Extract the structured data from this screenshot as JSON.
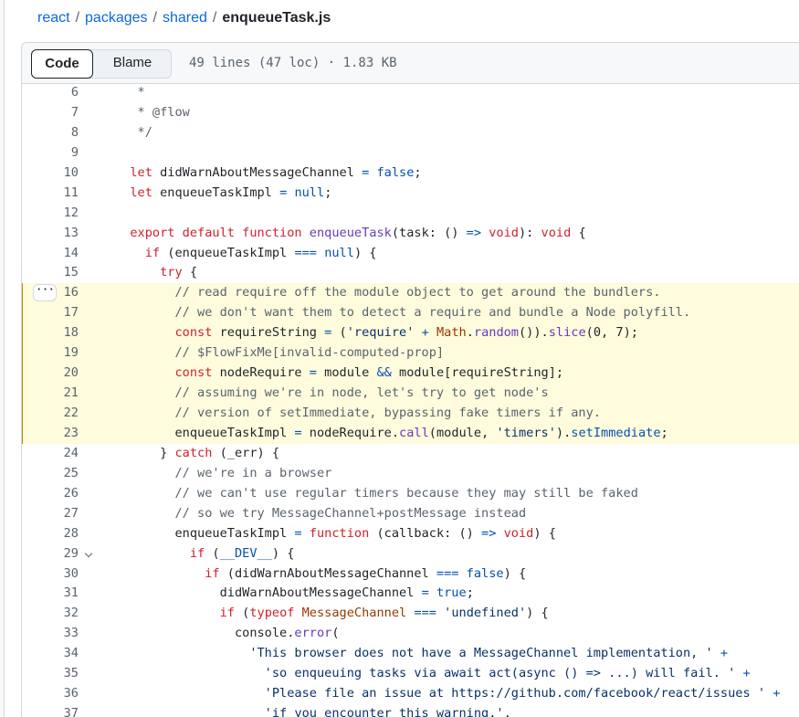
{
  "breadcrumb": {
    "items": [
      {
        "label": "react"
      },
      {
        "label": "packages"
      },
      {
        "label": "shared"
      }
    ],
    "current": "enqueueTask.js",
    "separator": "/"
  },
  "toolbar": {
    "code_label": "Code",
    "blame_label": "Blame",
    "file_info": "49 lines (47 loc) · 1.83 KB"
  },
  "colors": {
    "keyword": "#cf222e",
    "function": "#6639ba",
    "constant": "#0550ae",
    "string": "#0a3069",
    "comment": "#59636e",
    "highlight_bg": "#fffbdd",
    "highlight_bar": "#bf8700",
    "link": "#0969da"
  },
  "more_button_glyph": "···",
  "code_lines": [
    {
      "n": "6",
      "tokens": [
        {
          "t": "comment",
          "v": "   *"
        }
      ]
    },
    {
      "n": "7",
      "tokens": [
        {
          "t": "comment",
          "v": "   * @flow"
        }
      ]
    },
    {
      "n": "8",
      "tokens": [
        {
          "t": "comment",
          "v": "   */"
        }
      ]
    },
    {
      "n": "9",
      "tokens": []
    },
    {
      "n": "10",
      "tokens": [
        {
          "t": "keyword",
          "v": "  let "
        },
        {
          "t": "text",
          "v": "didWarnAboutMessageChannel "
        },
        {
          "t": "constant",
          "v": "="
        },
        {
          "t": "text",
          "v": " "
        },
        {
          "t": "constant",
          "v": "false"
        },
        {
          "t": "text",
          "v": ";"
        }
      ]
    },
    {
      "n": "11",
      "tokens": [
        {
          "t": "keyword",
          "v": "  let "
        },
        {
          "t": "text",
          "v": "enqueueTaskImpl "
        },
        {
          "t": "constant",
          "v": "="
        },
        {
          "t": "text",
          "v": " "
        },
        {
          "t": "constant",
          "v": "null"
        },
        {
          "t": "text",
          "v": ";"
        }
      ]
    },
    {
      "n": "12",
      "tokens": []
    },
    {
      "n": "13",
      "tokens": [
        {
          "t": "keyword",
          "v": "  export default function "
        },
        {
          "t": "function",
          "v": "enqueueTask"
        },
        {
          "t": "text",
          "v": "(task: () "
        },
        {
          "t": "constant",
          "v": "=>"
        },
        {
          "t": "text",
          "v": " "
        },
        {
          "t": "keyword",
          "v": "void"
        },
        {
          "t": "text",
          "v": "): "
        },
        {
          "t": "keyword",
          "v": "void"
        },
        {
          "t": "text",
          "v": " {"
        }
      ]
    },
    {
      "n": "14",
      "tokens": [
        {
          "t": "keyword",
          "v": "    if "
        },
        {
          "t": "text",
          "v": "(enqueueTaskImpl "
        },
        {
          "t": "constant",
          "v": "==="
        },
        {
          "t": "text",
          "v": " "
        },
        {
          "t": "constant",
          "v": "null"
        },
        {
          "t": "text",
          "v": ") {"
        }
      ]
    },
    {
      "n": "15",
      "tokens": [
        {
          "t": "keyword",
          "v": "      try "
        },
        {
          "t": "text",
          "v": "{"
        }
      ]
    },
    {
      "n": "16",
      "hl": true,
      "more": true,
      "tokens": [
        {
          "t": "comment",
          "v": "        // read require off the module object to get around the bundlers."
        }
      ]
    },
    {
      "n": "17",
      "hl": true,
      "tokens": [
        {
          "t": "comment",
          "v": "        // we don't want them to detect a require and bundle a Node polyfill."
        }
      ]
    },
    {
      "n": "18",
      "hl": true,
      "tokens": [
        {
          "t": "keyword",
          "v": "        const "
        },
        {
          "t": "text",
          "v": "requireString "
        },
        {
          "t": "constant",
          "v": "="
        },
        {
          "t": "text",
          "v": " ("
        },
        {
          "t": "string",
          "v": "'require'"
        },
        {
          "t": "text",
          "v": " "
        },
        {
          "t": "constant",
          "v": "+"
        },
        {
          "t": "text",
          "v": " "
        },
        {
          "t": "type",
          "v": "Math"
        },
        {
          "t": "text",
          "v": "."
        },
        {
          "t": "function",
          "v": "random"
        },
        {
          "t": "text",
          "v": "())."
        },
        {
          "t": "function",
          "v": "slice"
        },
        {
          "t": "text",
          "v": "(0, 7);"
        }
      ]
    },
    {
      "n": "19",
      "hl": true,
      "tokens": [
        {
          "t": "comment",
          "v": "        // $FlowFixMe[invalid-computed-prop]"
        }
      ]
    },
    {
      "n": "20",
      "hl": true,
      "tokens": [
        {
          "t": "keyword",
          "v": "        const "
        },
        {
          "t": "text",
          "v": "nodeRequire "
        },
        {
          "t": "constant",
          "v": "="
        },
        {
          "t": "text",
          "v": " module "
        },
        {
          "t": "constant",
          "v": "&&"
        },
        {
          "t": "text",
          "v": " module[requireString];"
        }
      ]
    },
    {
      "n": "21",
      "hl": true,
      "tokens": [
        {
          "t": "comment",
          "v": "        // assuming we're in node, let's try to get node's"
        }
      ]
    },
    {
      "n": "22",
      "hl": true,
      "tokens": [
        {
          "t": "comment",
          "v": "        // version of setImmediate, bypassing fake timers if any."
        }
      ]
    },
    {
      "n": "23",
      "hl": true,
      "tokens": [
        {
          "t": "text",
          "v": "        enqueueTaskImpl "
        },
        {
          "t": "constant",
          "v": "="
        },
        {
          "t": "text",
          "v": " nodeRequire."
        },
        {
          "t": "function",
          "v": "call"
        },
        {
          "t": "text",
          "v": "(module, "
        },
        {
          "t": "string",
          "v": "'timers'"
        },
        {
          "t": "text",
          "v": ")."
        },
        {
          "t": "constant",
          "v": "setImmediate"
        },
        {
          "t": "text",
          "v": ";"
        }
      ]
    },
    {
      "n": "24",
      "tokens": [
        {
          "t": "text",
          "v": "      } "
        },
        {
          "t": "keyword",
          "v": "catch"
        },
        {
          "t": "text",
          "v": " (_err) {"
        }
      ]
    },
    {
      "n": "25",
      "tokens": [
        {
          "t": "comment",
          "v": "        // we're in a browser"
        }
      ]
    },
    {
      "n": "26",
      "tokens": [
        {
          "t": "comment",
          "v": "        // we can't use regular timers because they may still be faked"
        }
      ]
    },
    {
      "n": "27",
      "tokens": [
        {
          "t": "comment",
          "v": "        // so we try MessageChannel+postMessage instead"
        }
      ]
    },
    {
      "n": "28",
      "tokens": [
        {
          "t": "text",
          "v": "        enqueueTaskImpl "
        },
        {
          "t": "constant",
          "v": "="
        },
        {
          "t": "text",
          "v": " "
        },
        {
          "t": "keyword",
          "v": "function"
        },
        {
          "t": "text",
          "v": " (callback: () "
        },
        {
          "t": "constant",
          "v": "=>"
        },
        {
          "t": "text",
          "v": " "
        },
        {
          "t": "keyword",
          "v": "void"
        },
        {
          "t": "text",
          "v": ") {"
        }
      ]
    },
    {
      "n": "29",
      "fold": true,
      "tokens": [
        {
          "t": "keyword",
          "v": "          if "
        },
        {
          "t": "text",
          "v": "("
        },
        {
          "t": "constant",
          "v": "__DEV__"
        },
        {
          "t": "text",
          "v": ") {"
        }
      ]
    },
    {
      "n": "30",
      "tokens": [
        {
          "t": "keyword",
          "v": "            if "
        },
        {
          "t": "text",
          "v": "(didWarnAboutMessageChannel "
        },
        {
          "t": "constant",
          "v": "==="
        },
        {
          "t": "text",
          "v": " "
        },
        {
          "t": "constant",
          "v": "false"
        },
        {
          "t": "text",
          "v": ") {"
        }
      ]
    },
    {
      "n": "31",
      "tokens": [
        {
          "t": "text",
          "v": "              didWarnAboutMessageChannel "
        },
        {
          "t": "constant",
          "v": "="
        },
        {
          "t": "text",
          "v": " "
        },
        {
          "t": "constant",
          "v": "true"
        },
        {
          "t": "text",
          "v": ";"
        }
      ]
    },
    {
      "n": "32",
      "tokens": [
        {
          "t": "keyword",
          "v": "              if "
        },
        {
          "t": "text",
          "v": "("
        },
        {
          "t": "keyword",
          "v": "typeof"
        },
        {
          "t": "text",
          "v": " "
        },
        {
          "t": "type",
          "v": "MessageChannel"
        },
        {
          "t": "text",
          "v": " "
        },
        {
          "t": "constant",
          "v": "==="
        },
        {
          "t": "text",
          "v": " "
        },
        {
          "t": "string",
          "v": "'undefined'"
        },
        {
          "t": "text",
          "v": ") {"
        }
      ]
    },
    {
      "n": "33",
      "tokens": [
        {
          "t": "text",
          "v": "                console."
        },
        {
          "t": "function",
          "v": "error"
        },
        {
          "t": "text",
          "v": "("
        }
      ]
    },
    {
      "n": "34",
      "tokens": [
        {
          "t": "string",
          "v": "                  'This browser does not have a MessageChannel implementation, '"
        },
        {
          "t": "text",
          "v": " "
        },
        {
          "t": "constant",
          "v": "+"
        }
      ]
    },
    {
      "n": "35",
      "tokens": [
        {
          "t": "string",
          "v": "                    'so enqueuing tasks via await act(async () => ...) will fail. '"
        },
        {
          "t": "text",
          "v": " "
        },
        {
          "t": "constant",
          "v": "+"
        }
      ]
    },
    {
      "n": "36",
      "tokens": [
        {
          "t": "string",
          "v": "                    'Please file an issue at https://github.com/facebook/react/issues '"
        },
        {
          "t": "text",
          "v": " "
        },
        {
          "t": "constant",
          "v": "+"
        }
      ]
    },
    {
      "n": "37",
      "tokens": [
        {
          "t": "string",
          "v": "                    'if you encounter this warning.'"
        },
        {
          "t": "text",
          "v": ","
        }
      ]
    }
  ]
}
